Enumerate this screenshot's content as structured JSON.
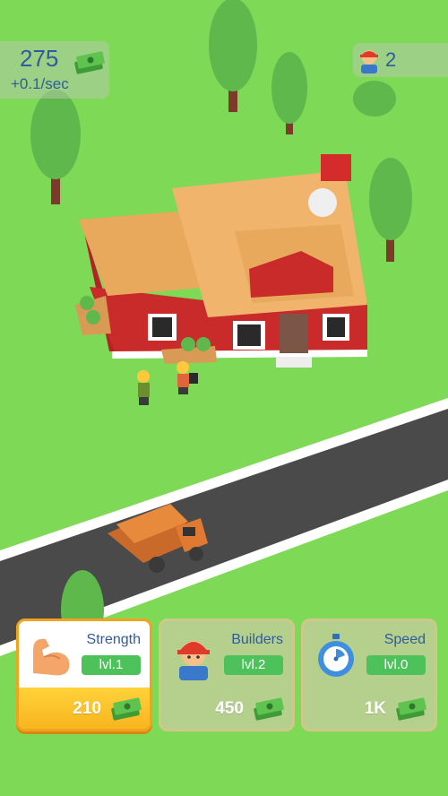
{
  "hud": {
    "money": "275",
    "income_rate": "+0.1/sec",
    "workers": "2"
  },
  "upgrades": [
    {
      "title": "Strength",
      "level": "lvl.1",
      "price": "210",
      "icon": "flexed-bicep-icon",
      "state": "affordable"
    },
    {
      "title": "Builders",
      "level": "lvl.2",
      "price": "450",
      "icon": "builder-icon",
      "state": "locked"
    },
    {
      "title": "Speed",
      "level": "lvl.0",
      "price": "1K",
      "icon": "stopwatch-icon",
      "state": "locked"
    }
  ],
  "colors": {
    "grass": "#7ed957",
    "road": "#4a4a4a",
    "house_wall": "#c92a2a",
    "roof": "#e8a95c",
    "text_blue": "#2f5c9c",
    "level_badge": "#4dc25a",
    "active_card_border": "#f0a41e"
  }
}
